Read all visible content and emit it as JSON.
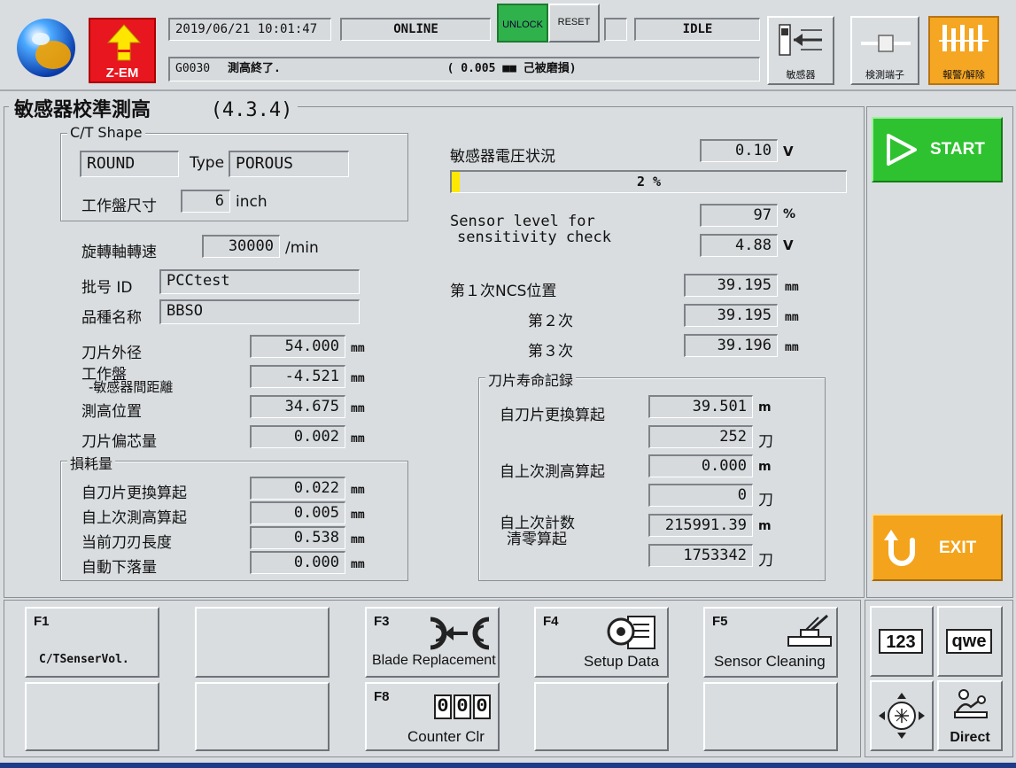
{
  "header": {
    "app_logo_text": "Z-EM",
    "datetime": "2019/06/21 10:01:47",
    "status": "ONLINE",
    "unlock_label": "UNLOCK",
    "reset_label": "RESET",
    "state": "IDLE",
    "message_code": "G0030",
    "message_text": "測高終了.",
    "message_detail": "(  0.005 ■■       己被磨損)",
    "sensor_button_label": "敏感器",
    "probe_button_label": "検測端子",
    "alarm_button_label": "報警/解除",
    "colors": {
      "unlock": "#2fb24b",
      "alarm": "#f5a623",
      "start": "#2ec230",
      "exit": "#f3a41c",
      "zem": "#e8161e"
    }
  },
  "page": {
    "title": "敏感器校準測高",
    "version": "(4.3.4)"
  },
  "ct_shape": {
    "title": "C/T Shape",
    "shape": "ROUND",
    "type_label": "Type",
    "type": "POROUS",
    "table_size_label": "工作盤尺寸",
    "table_size": "6",
    "table_size_unit": "inch"
  },
  "spindle": {
    "label": "旋轉軸轉速",
    "value": "30000",
    "unit": "/min"
  },
  "lot_id": {
    "label": "批号 ID",
    "value": "PCCtest"
  },
  "device": {
    "label": "品種名称",
    "value": "BBSO"
  },
  "blade": {
    "od_label": "刀片外径",
    "od": "54.000",
    "od_unit": "mm",
    "dist_label1": "工作盤",
    "dist_label2": "-敏感器間距離",
    "dist": "-4.521",
    "dist_unit": "mm",
    "height_label": "測高位置",
    "height": "34.675",
    "height_unit": "mm",
    "ecc_label": "刀片偏芯量",
    "ecc": "0.002",
    "ecc_unit": "mm"
  },
  "wear": {
    "title": "損耗量",
    "rows": [
      {
        "label": "自刀片更換算起",
        "value": "0.022",
        "unit": "mm"
      },
      {
        "label": "自上次測高算起",
        "value": "0.005",
        "unit": "mm"
      },
      {
        "label": "当前刀刃長度",
        "value": "0.538",
        "unit": "mm"
      },
      {
        "label": "自動下落量",
        "value": "0.000",
        "unit": "mm"
      }
    ]
  },
  "sensor": {
    "voltage_label": "敏感器電圧状況",
    "voltage": "0.10",
    "voltage_unit": "V",
    "level_bar_text": "2 %",
    "level_fraction": 0.02,
    "sens_label1": "Sensor level for",
    "sens_label2": "sensitivity check",
    "sens_pct": "97",
    "sens_pct_unit": "%",
    "sens_v": "4.88",
    "sens_v_unit": "V"
  },
  "ncs": {
    "first_label": "第１次NCS位置",
    "first": "39.195",
    "second_label": "第２次",
    "second": "39.195",
    "third_label": "第３次",
    "third": "39.196",
    "unit": "mm"
  },
  "life": {
    "title": "刀片寿命記録",
    "since_replace_label": "自刀片更換算起",
    "since_replace_m": "39.501",
    "since_replace_cut": "252",
    "since_measure_label": "自上次測高算起",
    "since_measure_m": "0.000",
    "since_measure_cut": "0",
    "since_clear_label1": "自上次計数",
    "since_clear_label2": "清零算起",
    "since_clear_m": "215991.39",
    "since_clear_cut": "1753342",
    "unit_m": "m",
    "unit_cut": "刀"
  },
  "side": {
    "start": "START",
    "exit": "EXIT"
  },
  "fkeys": {
    "f1_key": "F1",
    "f1_label": "C/TSenserVol.",
    "f3_key": "F3",
    "f3_label": "Blade Replacement",
    "f4_key": "F4",
    "f4_label": "Setup Data",
    "f5_key": "F5",
    "f5_label": "Sensor Cleaning",
    "f8_key": "F8",
    "f8_label": "Counter Clr",
    "f8_digits": "000"
  },
  "corner": {
    "num_label": "123",
    "alpha_label": "qwe",
    "direct_label": "Direct"
  }
}
